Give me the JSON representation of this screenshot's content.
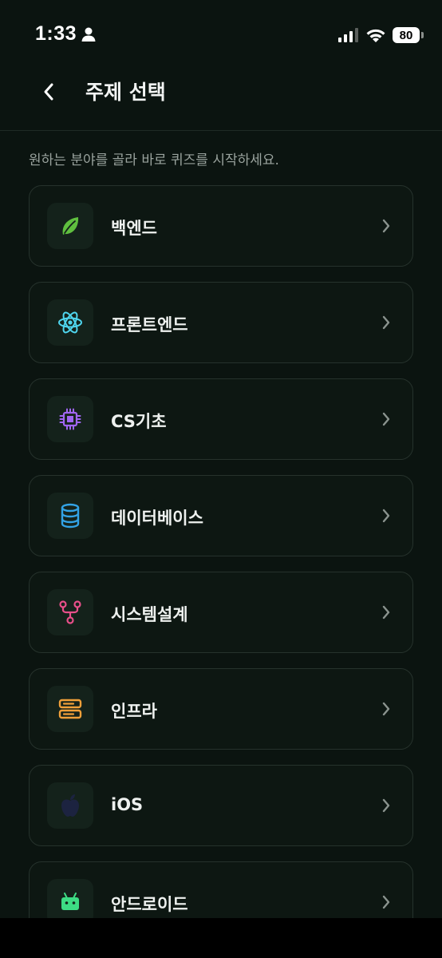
{
  "status_bar": {
    "time": "1:33",
    "battery": "80"
  },
  "header": {
    "title": "주제 선택"
  },
  "subtitle": "원하는 분야를 골라 바로 퀴즈를 시작하세요.",
  "topics": [
    {
      "label": "백엔드",
      "icon": "leaf-icon",
      "color": "#5fbf3f"
    },
    {
      "label": "프론트엔드",
      "icon": "atom-icon",
      "color": "#4fd6ef"
    },
    {
      "label": "CS기초",
      "icon": "chip-icon",
      "color": "#a066f2"
    },
    {
      "label": "데이터베이스",
      "icon": "database-icon",
      "color": "#33a3e6"
    },
    {
      "label": "시스템설계",
      "icon": "network-icon",
      "color": "#e84f8a"
    },
    {
      "label": "인프라",
      "icon": "server-icon",
      "color": "#f0a03a"
    },
    {
      "label": "iOS",
      "icon": "apple-icon",
      "color": "#1c2340"
    },
    {
      "label": "안드로이드",
      "icon": "android-icon",
      "color": "#3ddc84"
    }
  ]
}
